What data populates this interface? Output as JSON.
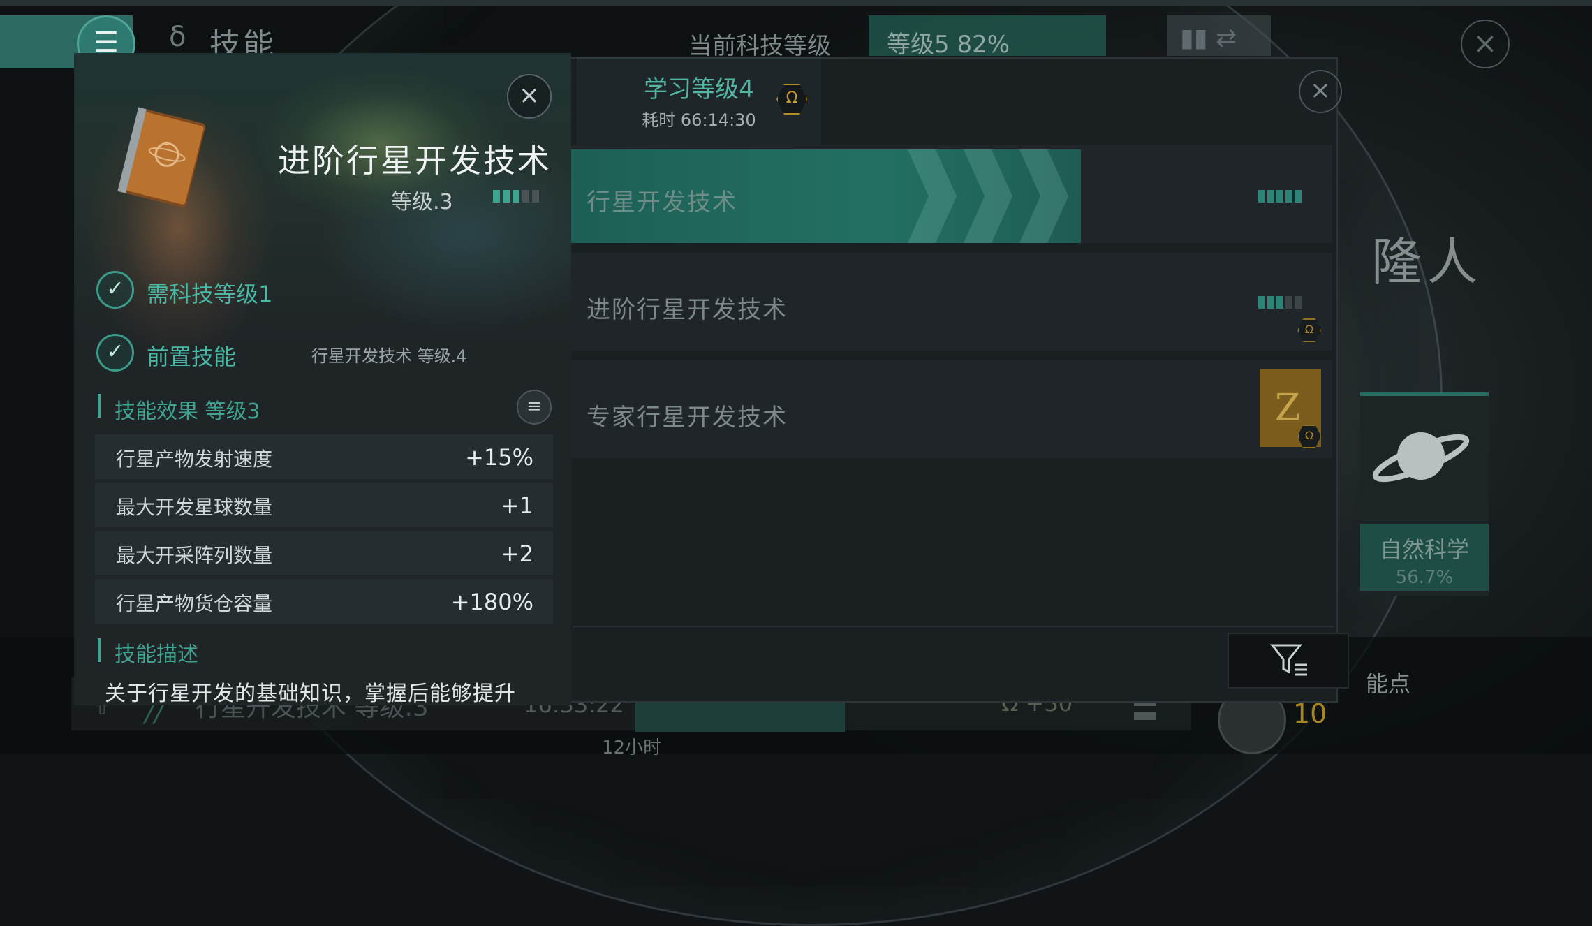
{
  "colors": {
    "accent": "#3fa390",
    "gold": "#c79b2a",
    "panel": "#1f2427"
  },
  "header": {
    "title": "技能",
    "tech_level_label": "当前科技等级",
    "tech_level_value": "等级5  82%"
  },
  "study": {
    "title": "学习等级4",
    "time": "耗时 66:14:30",
    "omega_icon": "Ω"
  },
  "skills": [
    {
      "name": "行星开发技术"
    },
    {
      "name": "进阶行星开发技术"
    },
    {
      "name": "专家行星开发技术"
    }
  ],
  "detail": {
    "title": "进阶行星开发技术",
    "level": "等级.3",
    "level_pips_filled": 3,
    "level_pips_total": 5,
    "requirements": [
      {
        "label": "需科技等级1",
        "sub": ""
      },
      {
        "label": "前置技能",
        "sub": "行星开发技术 等级.4"
      }
    ],
    "effects_title": "技能效果 等级3",
    "effects": [
      {
        "name": "行星产物发射速度",
        "value": "+15%"
      },
      {
        "name": "最大开发星球数量",
        "value": "+1"
      },
      {
        "name": "最大开采阵列数量",
        "value": "+2"
      },
      {
        "name": "行星产物货仓容量",
        "value": "+180%"
      }
    ],
    "description_title": "技能描述",
    "description": "关于行星开发的基础知识，掌握后能够提升"
  },
  "background": {
    "name": "隆人",
    "card_label": "自然科学",
    "card_pct": "56.7%",
    "points_label": "能点",
    "points_value": "10",
    "bottom_skill": "行星开发技术 等级.3",
    "bottom_time": "16:33:22",
    "bottom_cost": "Ω +30",
    "bottom_hours": "12小时"
  }
}
